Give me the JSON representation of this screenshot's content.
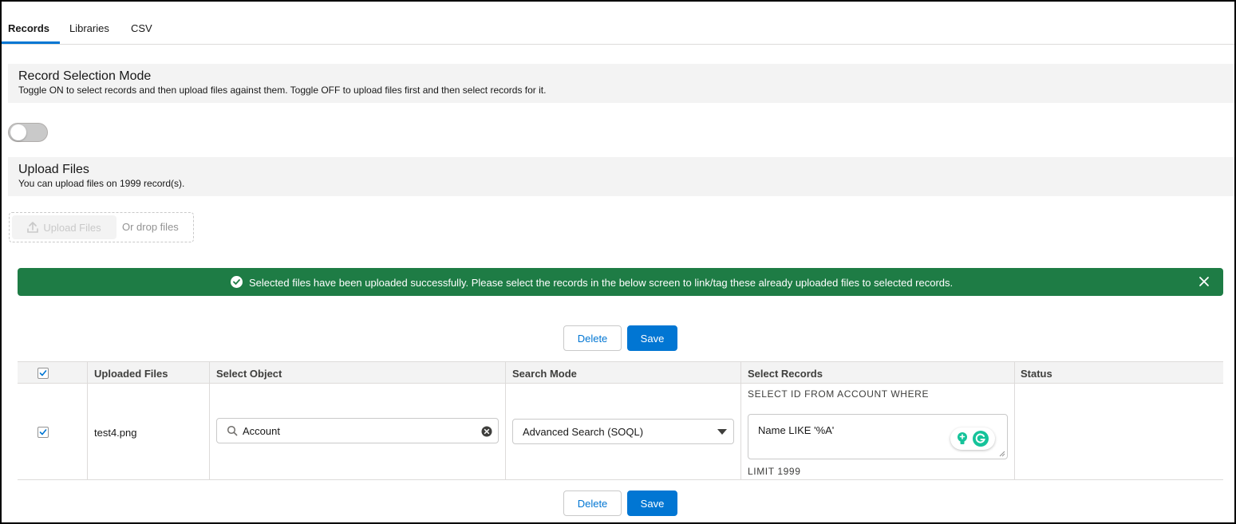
{
  "tabs": [
    {
      "label": "Records",
      "active": true
    },
    {
      "label": "Libraries",
      "active": false
    },
    {
      "label": "CSV",
      "active": false
    }
  ],
  "record_selection": {
    "title": "Record Selection Mode",
    "description": "Toggle ON to select records and then upload files against them. Toggle OFF to upload files first and then select records for it.",
    "toggle_on": false
  },
  "upload": {
    "title": "Upload Files",
    "description": "You can upload files on 1999 record(s).",
    "button_label": "Upload Files",
    "drop_label": "Or drop files"
  },
  "toast": {
    "message": "Selected files have been uploaded successfully. Please select the records in the below screen to link/tag these already uploaded files to selected records.",
    "color": "#1e7c45"
  },
  "actions": {
    "delete_label": "Delete",
    "save_label": "Save"
  },
  "table": {
    "headers": [
      "Uploaded Files",
      "Select Object",
      "Search Mode",
      "Select Records",
      "Status"
    ],
    "header_checked": true,
    "rows": [
      {
        "checked": true,
        "file": "test4.png",
        "object": "Account",
        "search_mode": "Advanced Search (SOQL)",
        "soql_prefix": "SELECT ID FROM ACCOUNT WHERE",
        "soql_where": "Name LIKE '%A'",
        "soql_suffix": "LIMIT 1999",
        "status": ""
      }
    ]
  },
  "colors": {
    "brand": "#0176d3",
    "success": "#1e7c45",
    "header_bg": "#f3f3f3"
  }
}
